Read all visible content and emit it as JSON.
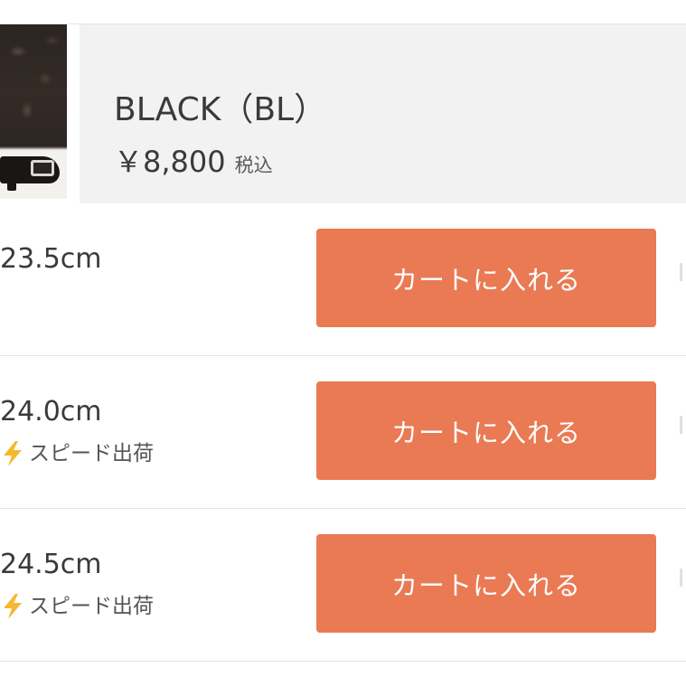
{
  "product": {
    "color_name": "BLACK（BL）",
    "price": "￥8,800",
    "tax_label": "税込",
    "thumbnail": "black-pumps-thumbnail"
  },
  "sizes": [
    {
      "size": "23.5cm",
      "speed_label": "",
      "button_label": "カートに入れる"
    },
    {
      "size": "24.0cm",
      "speed_label": "スピード出荷",
      "button_label": "カートに入れる"
    },
    {
      "size": "24.5cm",
      "speed_label": "スピード出荷",
      "button_label": "カートに入れる"
    }
  ],
  "colors": {
    "button_bg": "#e97a53",
    "header_bg": "#f2f2f2",
    "bolt": "#f5b82e"
  },
  "icons": {
    "speed": "lightning-bolt-icon"
  }
}
